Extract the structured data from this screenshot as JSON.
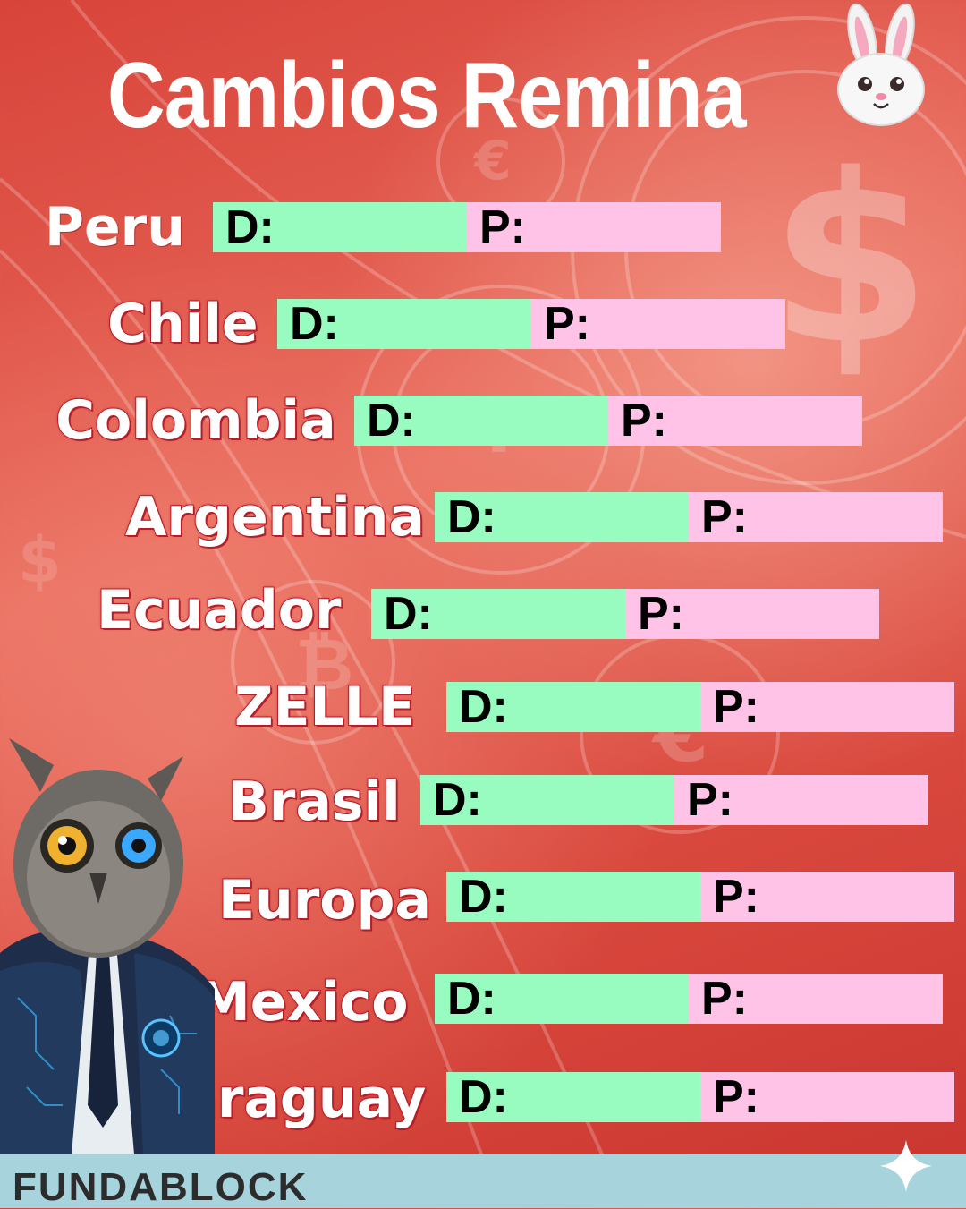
{
  "title": "Cambios Remina",
  "bunny_icon": "rabbit-face-icon",
  "rows": [
    {
      "country": "Peru",
      "d_label": "D:",
      "p_label": "P:"
    },
    {
      "country": "Chile",
      "d_label": "D:",
      "p_label": "P:"
    },
    {
      "country": "Colombia",
      "d_label": "D:",
      "p_label": "P:"
    },
    {
      "country": "Argentina",
      "d_label": "D:",
      "p_label": "P:"
    },
    {
      "country": "Ecuador",
      "d_label": "D:",
      "p_label": "P:"
    },
    {
      "country": "ZELLE",
      "d_label": "D:",
      "p_label": "P:"
    },
    {
      "country": "Brasil",
      "d_label": "D:",
      "p_label": "P:"
    },
    {
      "country": "Europa",
      "d_label": "D:",
      "p_label": "P:"
    },
    {
      "country": "Mexico",
      "d_label": "D:",
      "p_label": "P:"
    },
    {
      "country": "Paraguay",
      "d_label": "D:",
      "p_label": "P:"
    }
  ],
  "footer": {
    "brand": "FUNDABLOCK"
  },
  "colors": {
    "background": "#d8443a",
    "d_box": "#98fbc0",
    "p_box": "#ffc3e8",
    "footer": "#a6d3dc",
    "label_outline": "#b51e2a"
  }
}
